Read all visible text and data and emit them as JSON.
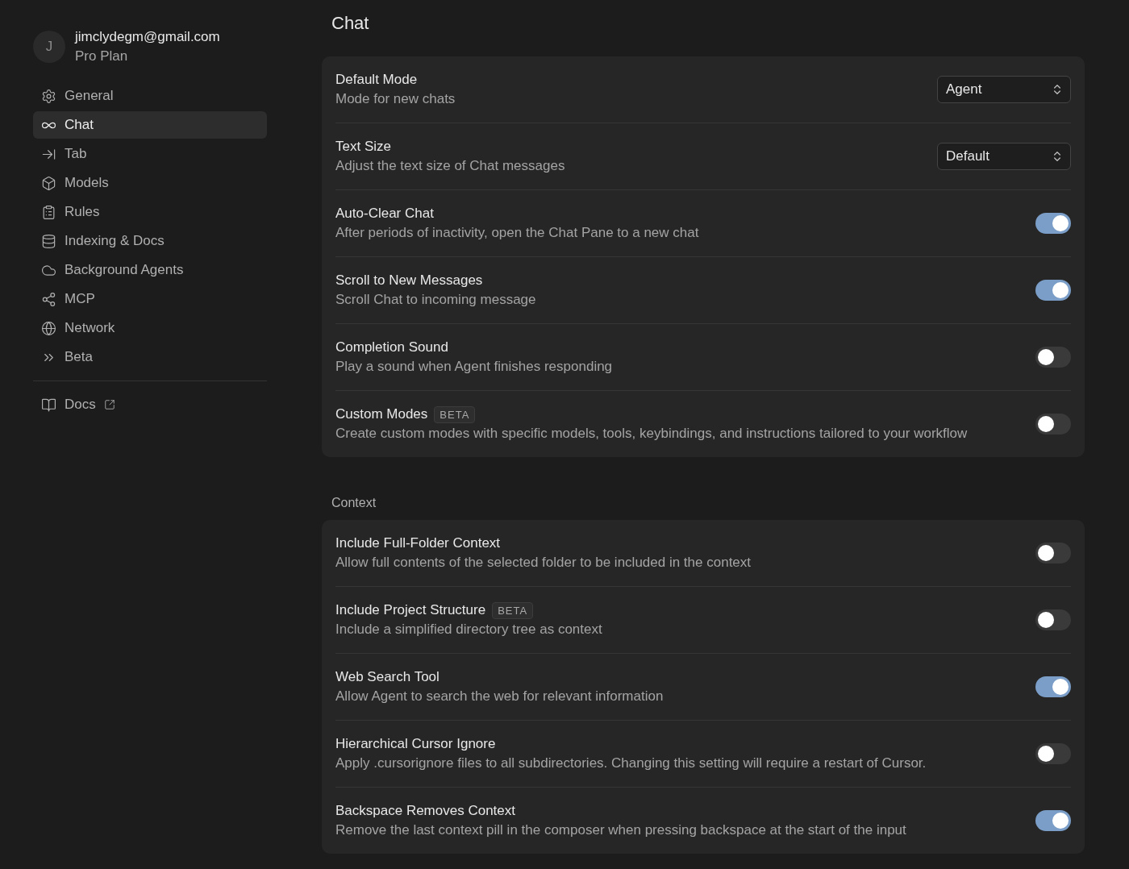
{
  "account": {
    "avatar": "J",
    "email": "jimclydegm@gmail.com",
    "plan": "Pro Plan"
  },
  "nav": [
    {
      "label": "General",
      "selected": false
    },
    {
      "label": "Chat",
      "selected": true
    },
    {
      "label": "Tab",
      "selected": false
    },
    {
      "label": "Models",
      "selected": false
    },
    {
      "label": "Rules",
      "selected": false
    },
    {
      "label": "Indexing & Docs",
      "selected": false
    },
    {
      "label": "Background Agents",
      "selected": false
    },
    {
      "label": "MCP",
      "selected": false
    },
    {
      "label": "Network",
      "selected": false
    },
    {
      "label": "Beta",
      "selected": false
    }
  ],
  "docs_link": {
    "label": "Docs"
  },
  "page_title": "Chat",
  "sections": [
    {
      "rows": [
        {
          "kind": "select",
          "title": "Default Mode",
          "description": "Mode for new chats",
          "value": "Agent"
        },
        {
          "kind": "select",
          "title": "Text Size",
          "description": "Adjust the text size of Chat messages",
          "value": "Default"
        },
        {
          "kind": "toggle",
          "title": "Auto-Clear Chat",
          "description": "After periods of inactivity, open the Chat Pane to a new chat",
          "on": true
        },
        {
          "kind": "toggle",
          "title": "Scroll to New Messages",
          "description": "Scroll Chat to incoming message",
          "on": true
        },
        {
          "kind": "toggle",
          "title": "Completion Sound",
          "description": "Play a sound when Agent finishes responding",
          "on": false
        },
        {
          "kind": "toggle",
          "title": "Custom Modes",
          "badge": "BETA",
          "description": "Create custom modes with specific models, tools, keybindings, and instructions tailored to your workflow",
          "on": false
        }
      ]
    },
    {
      "heading": "Context",
      "rows": [
        {
          "kind": "toggle",
          "title": "Include Full-Folder Context",
          "description": "Allow full contents of the selected folder to be included in the context",
          "on": false
        },
        {
          "kind": "toggle",
          "title": "Include Project Structure",
          "badge": "BETA",
          "description": "Include a simplified directory tree as context",
          "on": false
        },
        {
          "kind": "toggle",
          "title": "Web Search Tool",
          "description": "Allow Agent to search the web for relevant information",
          "on": true
        },
        {
          "kind": "toggle",
          "title": "Hierarchical Cursor Ignore",
          "description": "Apply .cursorignore files to all subdirectories. Changing this setting will require a restart of Cursor.",
          "on": false
        },
        {
          "kind": "toggle",
          "title": "Backspace Removes Context",
          "description": "Remove the last context pill in the composer when pressing backspace at the start of the input",
          "on": true
        }
      ]
    }
  ]
}
